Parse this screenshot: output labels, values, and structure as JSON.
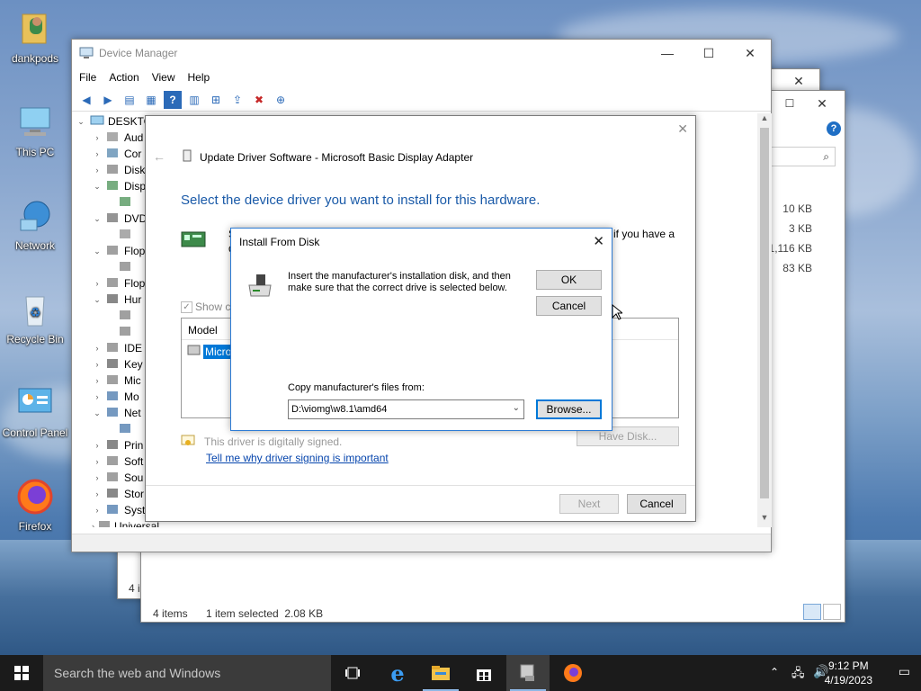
{
  "desktop": {
    "icons": [
      {
        "label": "dankpods",
        "icon": "user-folder-icon"
      },
      {
        "label": "This PC",
        "icon": "computer-icon"
      },
      {
        "label": "Network",
        "icon": "network-icon"
      },
      {
        "label": "Recycle Bin",
        "icon": "recycle-bin-icon"
      },
      {
        "label": "Control Panel",
        "icon": "control-panel-icon"
      },
      {
        "label": "Firefox",
        "icon": "firefox-icon"
      }
    ]
  },
  "explorer": {
    "sizes": [
      "10 KB",
      "3 KB",
      "1,116 KB",
      "83 KB"
    ],
    "status_items": "4 items",
    "status_selected": "1 item selected  2.08 KB",
    "status_items_back": "4 i"
  },
  "device_manager": {
    "title": "Device Manager",
    "menu": [
      "File",
      "Action",
      "View",
      "Help"
    ],
    "tree_root": "DESKTO",
    "tree": [
      {
        "label": "Aud",
        "arrow": "›"
      },
      {
        "label": "Cor",
        "arrow": "›"
      },
      {
        "label": "Disk",
        "arrow": "›"
      },
      {
        "label": "Disp",
        "arrow": "⌄"
      },
      {
        "label": "",
        "arrow": ""
      },
      {
        "label": "DVD",
        "arrow": "⌄"
      },
      {
        "label": "",
        "arrow": ""
      },
      {
        "label": "Flop",
        "arrow": "⌄"
      },
      {
        "label": "",
        "arrow": ""
      },
      {
        "label": "Flop",
        "arrow": "›"
      },
      {
        "label": "Hur",
        "arrow": "⌄"
      },
      {
        "label": "",
        "arrow": ""
      },
      {
        "label": "",
        "arrow": ""
      },
      {
        "label": "IDE",
        "arrow": "›"
      },
      {
        "label": "Key",
        "arrow": "›"
      },
      {
        "label": "Mic",
        "arrow": "›"
      },
      {
        "label": "Mo",
        "arrow": "›"
      },
      {
        "label": "Net",
        "arrow": "⌄"
      },
      {
        "label": "",
        "arrow": ""
      },
      {
        "label": "Prin",
        "arrow": "›"
      },
      {
        "label": "Soft",
        "arrow": "›"
      },
      {
        "label": "Sou",
        "arrow": "›"
      },
      {
        "label": "Stor",
        "arrow": "›"
      },
      {
        "label": "Syst",
        "arrow": "›"
      },
      {
        "label": "Universal Serial Bus controllers",
        "arrow": "›"
      }
    ]
  },
  "wizard": {
    "title": "Update Driver Software - Microsoft Basic Display Adapter",
    "heading": "Select the device driver you want to install for this hardware.",
    "side_text_1": "S",
    "side_text_2": "d",
    "right_text": "if you have a",
    "show_compatible": "Show co",
    "model_header": "Model",
    "model_item": "Micro",
    "signed_text": "This driver is digitally signed.",
    "signing_link": "Tell me why driver signing is important",
    "have_disk": "Have Disk...",
    "next": "Next",
    "cancel": "Cancel"
  },
  "install_dialog": {
    "title": "Install From Disk",
    "message": "Insert the manufacturer's installation disk, and then make sure that the correct drive is selected below.",
    "ok": "OK",
    "cancel": "Cancel",
    "copy_label": "Copy manufacturer's files from:",
    "path_value": "D:\\viomg\\w8.1\\amd64",
    "browse": "Browse..."
  },
  "taskbar": {
    "search_placeholder": "Search the web and Windows",
    "time": "9:12 PM",
    "date": "4/19/2023"
  },
  "colors": {
    "accent": "#0078d7",
    "heading_blue": "#1a5aa8",
    "taskbar": "#1b1b1b"
  }
}
